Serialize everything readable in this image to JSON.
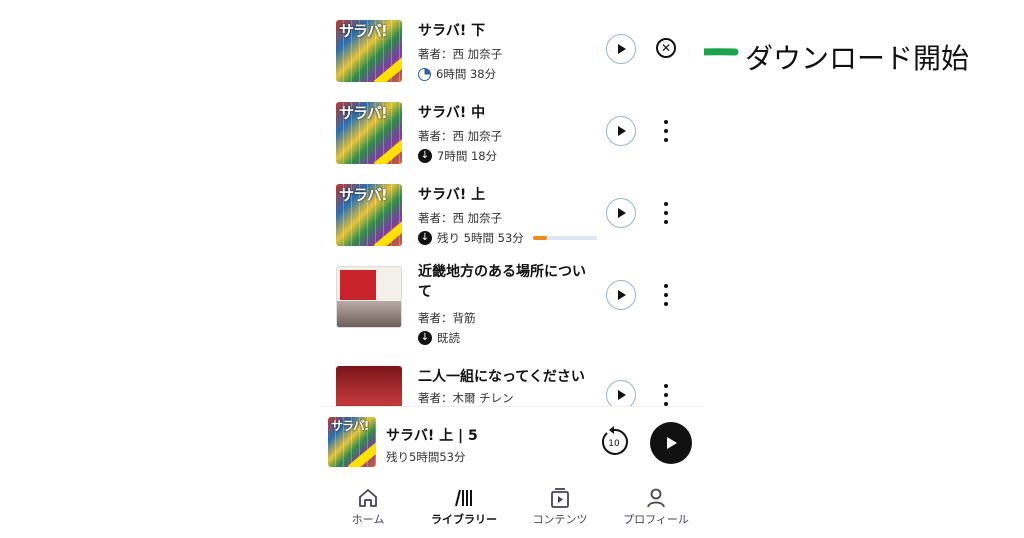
{
  "annotation": {
    "label": "ダウンロード開始",
    "arrow_color": "#1aa34a"
  },
  "library": {
    "items": [
      {
        "cover": "sarabah",
        "cover_text": "サラバ!",
        "title": "サラバ! 下",
        "author": "著者：西 加奈子",
        "status_icon": "progress-pie-icon",
        "status": "6時間 38分",
        "action": "cancel"
      },
      {
        "cover": "sarabah",
        "cover_text": "サラバ!",
        "title": "サラバ! 中",
        "author": "著者：西 加奈子",
        "status_icon": "download-icon",
        "status": "7時間 18分",
        "action": "more"
      },
      {
        "cover": "sarabah",
        "cover_text": "サラバ!",
        "title": "サラバ! 上",
        "author": "著者：西 加奈子",
        "status_icon": "download-icon",
        "status": "残り 5時間 53分",
        "progress": 0.22,
        "action": "more"
      },
      {
        "cover": "kinki",
        "title": "近畿地方のある場所について",
        "title_line1": "近畿地方のある場所につい",
        "title_line2": "て",
        "author": "著者：背筋",
        "status_icon": "download-icon",
        "status": "既読",
        "action": "more"
      },
      {
        "cover": "futari",
        "title": "二人一組になってください",
        "author": "著者：木爾 チレン",
        "action": "more"
      }
    ]
  },
  "mini_player": {
    "title": "サラバ! 上 | 5",
    "subtitle": "残り5時間53分",
    "cover_text": "サラバ!",
    "replay_seconds": "10"
  },
  "nav": {
    "home": "ホーム",
    "library": "ライブラリー",
    "contents": "コンテンツ",
    "profile": "プロフィール"
  },
  "colors": {
    "accent_blue": "#2f5ea8",
    "progress_orange": "#f08a1c",
    "text": "#111111"
  }
}
